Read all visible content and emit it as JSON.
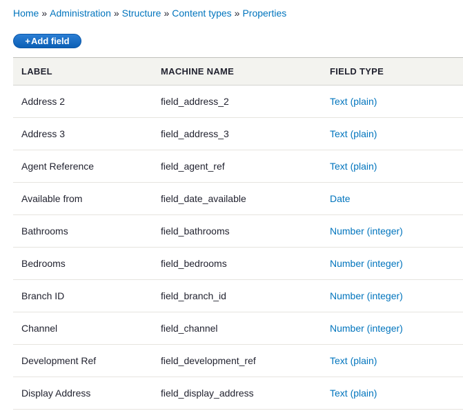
{
  "breadcrumb": [
    "Home",
    "Administration",
    "Structure",
    "Content types",
    "Properties"
  ],
  "breadcrumb_separator": "»",
  "toolbar": {
    "add_field_label": "Add field",
    "add_field_icon": "+"
  },
  "table": {
    "headers": [
      "LABEL",
      "MACHINE NAME",
      "FIELD TYPE"
    ],
    "rows": [
      {
        "label": "Address 2",
        "machine_name": "field_address_2",
        "field_type": "Text (plain)"
      },
      {
        "label": "Address 3",
        "machine_name": "field_address_3",
        "field_type": "Text (plain)"
      },
      {
        "label": "Agent Reference",
        "machine_name": "field_agent_ref",
        "field_type": "Text (plain)"
      },
      {
        "label": "Available from",
        "machine_name": "field_date_available",
        "field_type": "Date"
      },
      {
        "label": "Bathrooms",
        "machine_name": "field_bathrooms",
        "field_type": "Number (integer)"
      },
      {
        "label": "Bedrooms",
        "machine_name": "field_bedrooms",
        "field_type": "Number (integer)"
      },
      {
        "label": "Branch ID",
        "machine_name": "field_branch_id",
        "field_type": "Number (integer)"
      },
      {
        "label": "Channel",
        "machine_name": "field_channel",
        "field_type": "Number (integer)"
      },
      {
        "label": "Development Ref",
        "machine_name": "field_development_ref",
        "field_type": "Text (plain)"
      },
      {
        "label": "Display Address",
        "machine_name": "field_display_address",
        "field_type": "Text (plain)"
      }
    ]
  },
  "colors": {
    "link": "#0074bd",
    "button": "#0b5fb5",
    "header_bg": "#f3f3ef"
  }
}
